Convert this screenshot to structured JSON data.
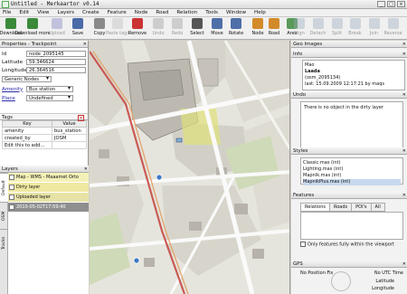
{
  "window": {
    "title": "Untitled - Merkaartor v0.14"
  },
  "menu": [
    "File",
    "Edit",
    "View",
    "Layers",
    "Create",
    "Feature",
    "Node",
    "Road",
    "Relation",
    "Tools",
    "Window",
    "Help"
  ],
  "toolbar": {
    "left": [
      {
        "label": "Download",
        "icon": "download-icon",
        "enabled": true
      },
      {
        "label": "Download more",
        "icon": "download-more-icon",
        "enabled": true
      },
      {
        "label": "Upload",
        "icon": "upload-icon",
        "enabled": false
      },
      {
        "label": "Save",
        "icon": "save-icon",
        "enabled": true
      },
      {
        "label": "Copy",
        "icon": "copy-icon",
        "enabled": true
      },
      {
        "label": "Paste tags",
        "icon": "paste-tags-icon",
        "enabled": false
      },
      {
        "label": "Remove",
        "icon": "remove-icon",
        "enabled": true
      },
      {
        "label": "Undo",
        "icon": "undo-icon",
        "enabled": false
      },
      {
        "label": "Redo",
        "icon": "redo-icon",
        "enabled": false
      },
      {
        "label": "Select",
        "icon": "select-icon",
        "enabled": true
      },
      {
        "label": "Move",
        "icon": "move-icon",
        "enabled": true
      },
      {
        "label": "Rotate",
        "icon": "rotate-icon",
        "enabled": true
      },
      {
        "label": "Node",
        "icon": "node-icon",
        "enabled": true
      },
      {
        "label": "Road",
        "icon": "road-icon",
        "enabled": true
      },
      {
        "label": "Area",
        "icon": "area-icon",
        "enabled": true
      }
    ],
    "right": [
      {
        "label": "Align",
        "icon": "align-icon",
        "enabled": false
      },
      {
        "label": "Detach",
        "icon": "detach-icon",
        "enabled": false
      },
      {
        "label": "Split",
        "icon": "split-icon",
        "enabled": false
      },
      {
        "label": "Break",
        "icon": "break-icon",
        "enabled": false
      },
      {
        "label": "Join",
        "icon": "join-icon",
        "enabled": false
      },
      {
        "label": "Reverse",
        "icon": "reverse-icon",
        "enabled": false
      }
    ]
  },
  "properties": {
    "header": "Properties - Trackpoint",
    "id_label": "Id",
    "id_value": "node_2095145",
    "lat_label": "Latitude",
    "lat_value": "59.346624",
    "lon_label": "Longitude",
    "lon_value": "26.364516",
    "preset": "Generic Nodes",
    "amenity_label": "Amenity",
    "amenity_value": "Bus station",
    "place_label": "Place",
    "place_value": "Undefined"
  },
  "tags": {
    "header": "Tags",
    "columns": [
      "Key",
      "Value"
    ],
    "rows": [
      [
        "amenity",
        "bus_station"
      ],
      [
        "created_by",
        "JOSM"
      ],
      [
        "Edit this to add...",
        ""
      ]
    ]
  },
  "layers": {
    "header": "Layers",
    "tabs": [
      "Default",
      "OSM",
      "Tracks"
    ],
    "items": [
      "Map - WMS - Maaamet Orto",
      "Dirty layer",
      "Uploaded layer",
      "2010-05-02T17:59:40 download"
    ]
  },
  "right": {
    "geo_images": "Geo Images",
    "info": {
      "header": "Info",
      "line1": "Mao",
      "line2": "Laada",
      "line3": "(osm_2095134)",
      "line4": "last: 15.09.2009 12:17:21 by maqs"
    },
    "undo": {
      "header": "Undo",
      "text": "There is no object in the dirty layer"
    },
    "styles": {
      "header": "Styles",
      "items": [
        "Classic.mas (int)",
        "Lighting.mas (int)",
        "MapnIk.mas (int)",
        "MapnikPlus.mas (int)"
      ]
    },
    "features": {
      "header": "Features",
      "tabs": [
        "Relations",
        "Roads",
        "POI's",
        "All"
      ],
      "checkbox_label": "Only features fully within the viewport"
    },
    "gps": {
      "header": "GPS",
      "fix": "No Position Fix",
      "time": "No UTC Time",
      "lat": "Latitude",
      "lon": "Longitude"
    }
  },
  "colors": {
    "road_red": "#c95a55",
    "road_orange": "#e2a874",
    "building": "#bfbcb4",
    "park": "#cfdab8",
    "highlight": "#dfe17a"
  }
}
